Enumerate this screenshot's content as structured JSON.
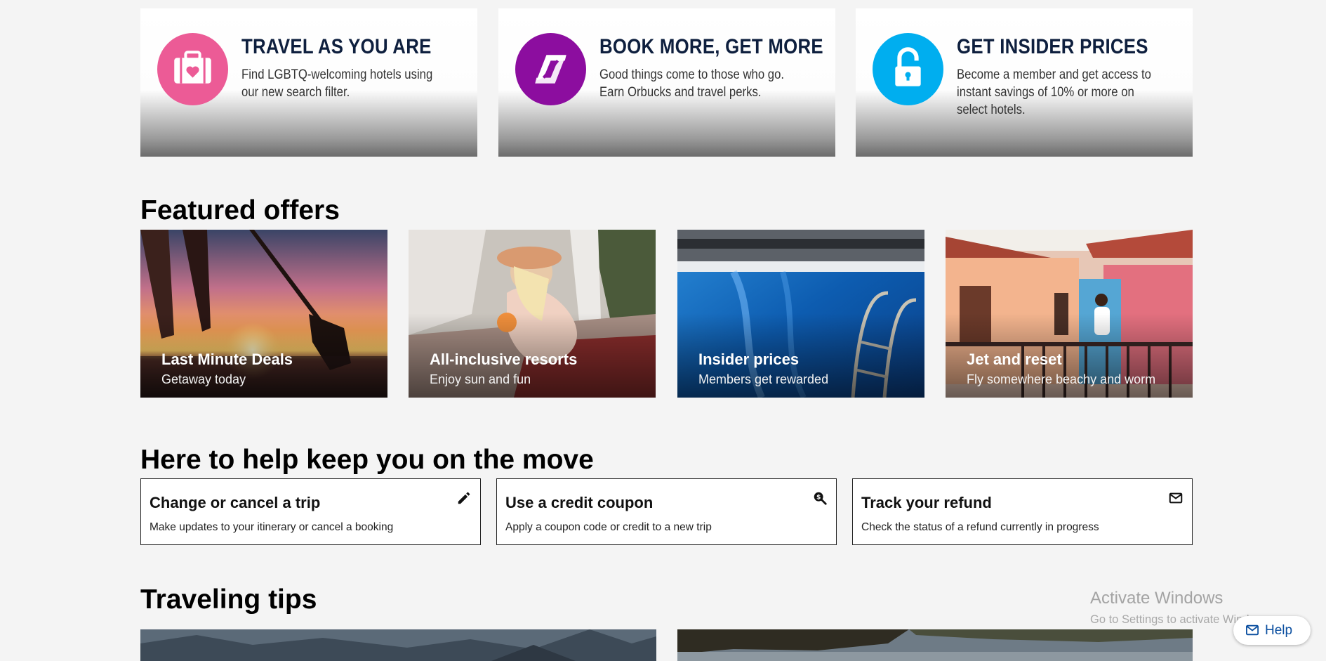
{
  "promos": [
    {
      "title": "TRAVEL AS YOU ARE",
      "text": "Find LGBTQ-welcoming hotels using our new search filter.",
      "icon": "suitcase-heart-icon",
      "color": "#ec5b96"
    },
    {
      "title": "BOOK MORE, GET MORE",
      "text": "Good things come to those who go. Earn Orbucks and travel perks.",
      "icon": "orbucks-icon",
      "color": "#8c0d9f"
    },
    {
      "title": "GET INSIDER PRICES",
      "text": "Become a member and get access to instant savings of 10% or more on select hotels.",
      "icon": "unlocked-padlock-icon",
      "color": "#00aeef"
    }
  ],
  "featured": {
    "heading": "Featured offers",
    "offers": [
      {
        "title": "Last Minute Deals",
        "subtitle": "Getaway today"
      },
      {
        "title": "All-inclusive resorts",
        "subtitle": "Enjoy sun and fun"
      },
      {
        "title": "Insider prices",
        "subtitle": "Members get rewarded"
      },
      {
        "title": "Jet and reset",
        "subtitle": "Fly somewhere beachy and worm"
      }
    ]
  },
  "help_section": {
    "heading": "Here to help keep you on the move",
    "cards": [
      {
        "title": "Change or cancel a trip",
        "text": "Make updates to your itinerary or cancel a booking",
        "icon": "pencil-icon"
      },
      {
        "title": "Use a credit coupon",
        "text": "Apply a coupon code or credit to a new trip",
        "icon": "coupon-search-icon"
      },
      {
        "title": "Track your refund",
        "text": "Check the status of a refund currently in progress",
        "icon": "envelope-icon"
      }
    ]
  },
  "tips": {
    "heading": "Traveling tips"
  },
  "watermark": {
    "title": "Activate Windows",
    "subtitle": "Go to Settings to activate Windows."
  },
  "help_button": {
    "label": "Help",
    "icon": "envelope-icon"
  }
}
